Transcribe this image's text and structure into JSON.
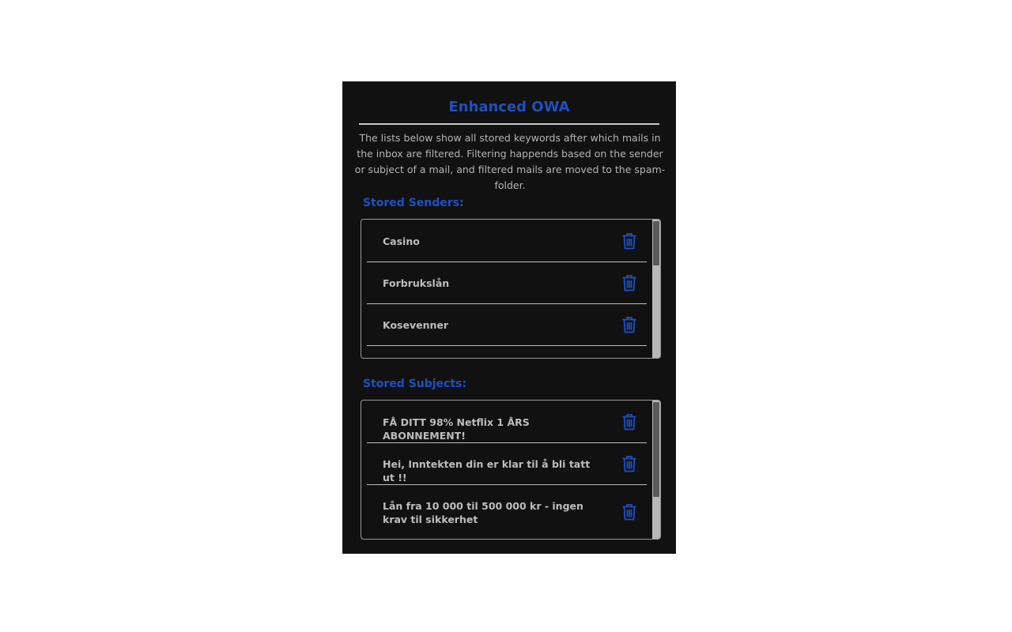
{
  "app": {
    "title": "Enhanced OWA",
    "description": "The lists below show all stored keywords after which mails in the inbox are filtered. Filtering happends based on the sender or subject of a mail, and filtered mails are moved to the spam-folder."
  },
  "senders": {
    "label": "Stored Senders:",
    "items": [
      {
        "text": "Casino",
        "icon": "trash-icon"
      },
      {
        "text": "Forbrukslån",
        "icon": "trash-icon"
      },
      {
        "text": "Kosevenner",
        "icon": "trash-icon"
      }
    ]
  },
  "subjects": {
    "label": "Stored Subjects:",
    "items": [
      {
        "text": "FÅ DITT 98% Netflix 1 ÅRS ABONNEMENT!",
        "icon": "trash-icon"
      },
      {
        "text": "Hei, Inntekten din er klar til å bli tatt ut !!",
        "icon": "trash-icon"
      },
      {
        "text": "Lån fra 10 000 til 500 000 kr - ingen krav til sikkerhet",
        "icon": "trash-icon"
      }
    ]
  },
  "colors": {
    "accent": "#1f4fc4",
    "background": "#111111",
    "text": "#bdbdbd"
  }
}
